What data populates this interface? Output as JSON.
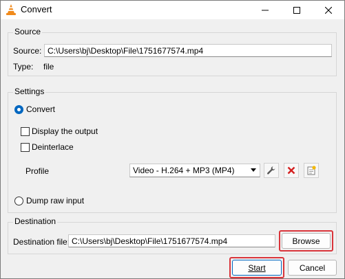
{
  "window": {
    "title": "Convert"
  },
  "source": {
    "group_title": "Source",
    "source_label": "Source:",
    "source_value": "C:\\Users\\bj\\Desktop\\File\\1751677574.mp4",
    "type_label": "Type:",
    "type_value": "file"
  },
  "settings": {
    "group_title": "Settings",
    "convert_label": "Convert",
    "display_output_label": "Display the output",
    "deinterlace_label": "Deinterlace",
    "profile_label": "Profile",
    "profile_selected": "Video - H.264 + MP3 (MP4)",
    "dump_raw_label": "Dump raw input"
  },
  "destination": {
    "group_title": "Destination",
    "file_label": "Destination file:",
    "file_value": "C:\\Users\\bj\\Desktop\\File\\1751677574.mp4",
    "browse_label": "Browse"
  },
  "buttons": {
    "start_label": "Start",
    "cancel_label": "Cancel"
  },
  "colors": {
    "accent": "#0067c0",
    "highlight": "#d9343a",
    "vlc_orange": "#f08a1c"
  }
}
